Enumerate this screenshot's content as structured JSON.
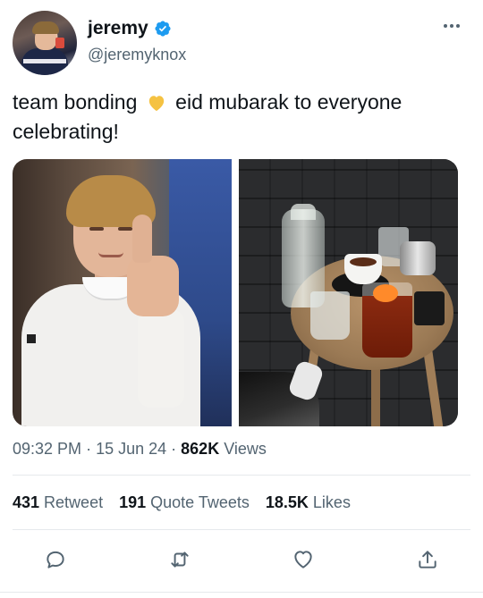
{
  "author": {
    "display_name": "jeremy",
    "handle": "@jeremyknox",
    "verified": true,
    "verified_color": "#1d9bf0"
  },
  "tweet": {
    "text_part1": "team bonding",
    "emoji": "yellow-heart",
    "text_part2": "eid mubarak to everyone celebrating!"
  },
  "media": {
    "count": 2,
    "items": [
      "photo-thumbs-up",
      "photo-cafe-table"
    ]
  },
  "meta": {
    "time": "09:32 PM",
    "date": "15 Jun 24",
    "views_count": "862K",
    "views_label": "Views"
  },
  "stats": {
    "retweets_count": "431",
    "retweets_label": "Retweet",
    "quotes_count": "191",
    "quotes_label": "Quote Tweets",
    "likes_count": "18.5K",
    "likes_label": "Likes"
  },
  "actions": [
    "reply-icon",
    "retweet-icon",
    "like-icon",
    "share-icon"
  ],
  "colors": {
    "text_primary": "#0f1419",
    "text_secondary": "#536471",
    "accent": "#1d9bf0",
    "heart_emoji": "#f5c242"
  }
}
